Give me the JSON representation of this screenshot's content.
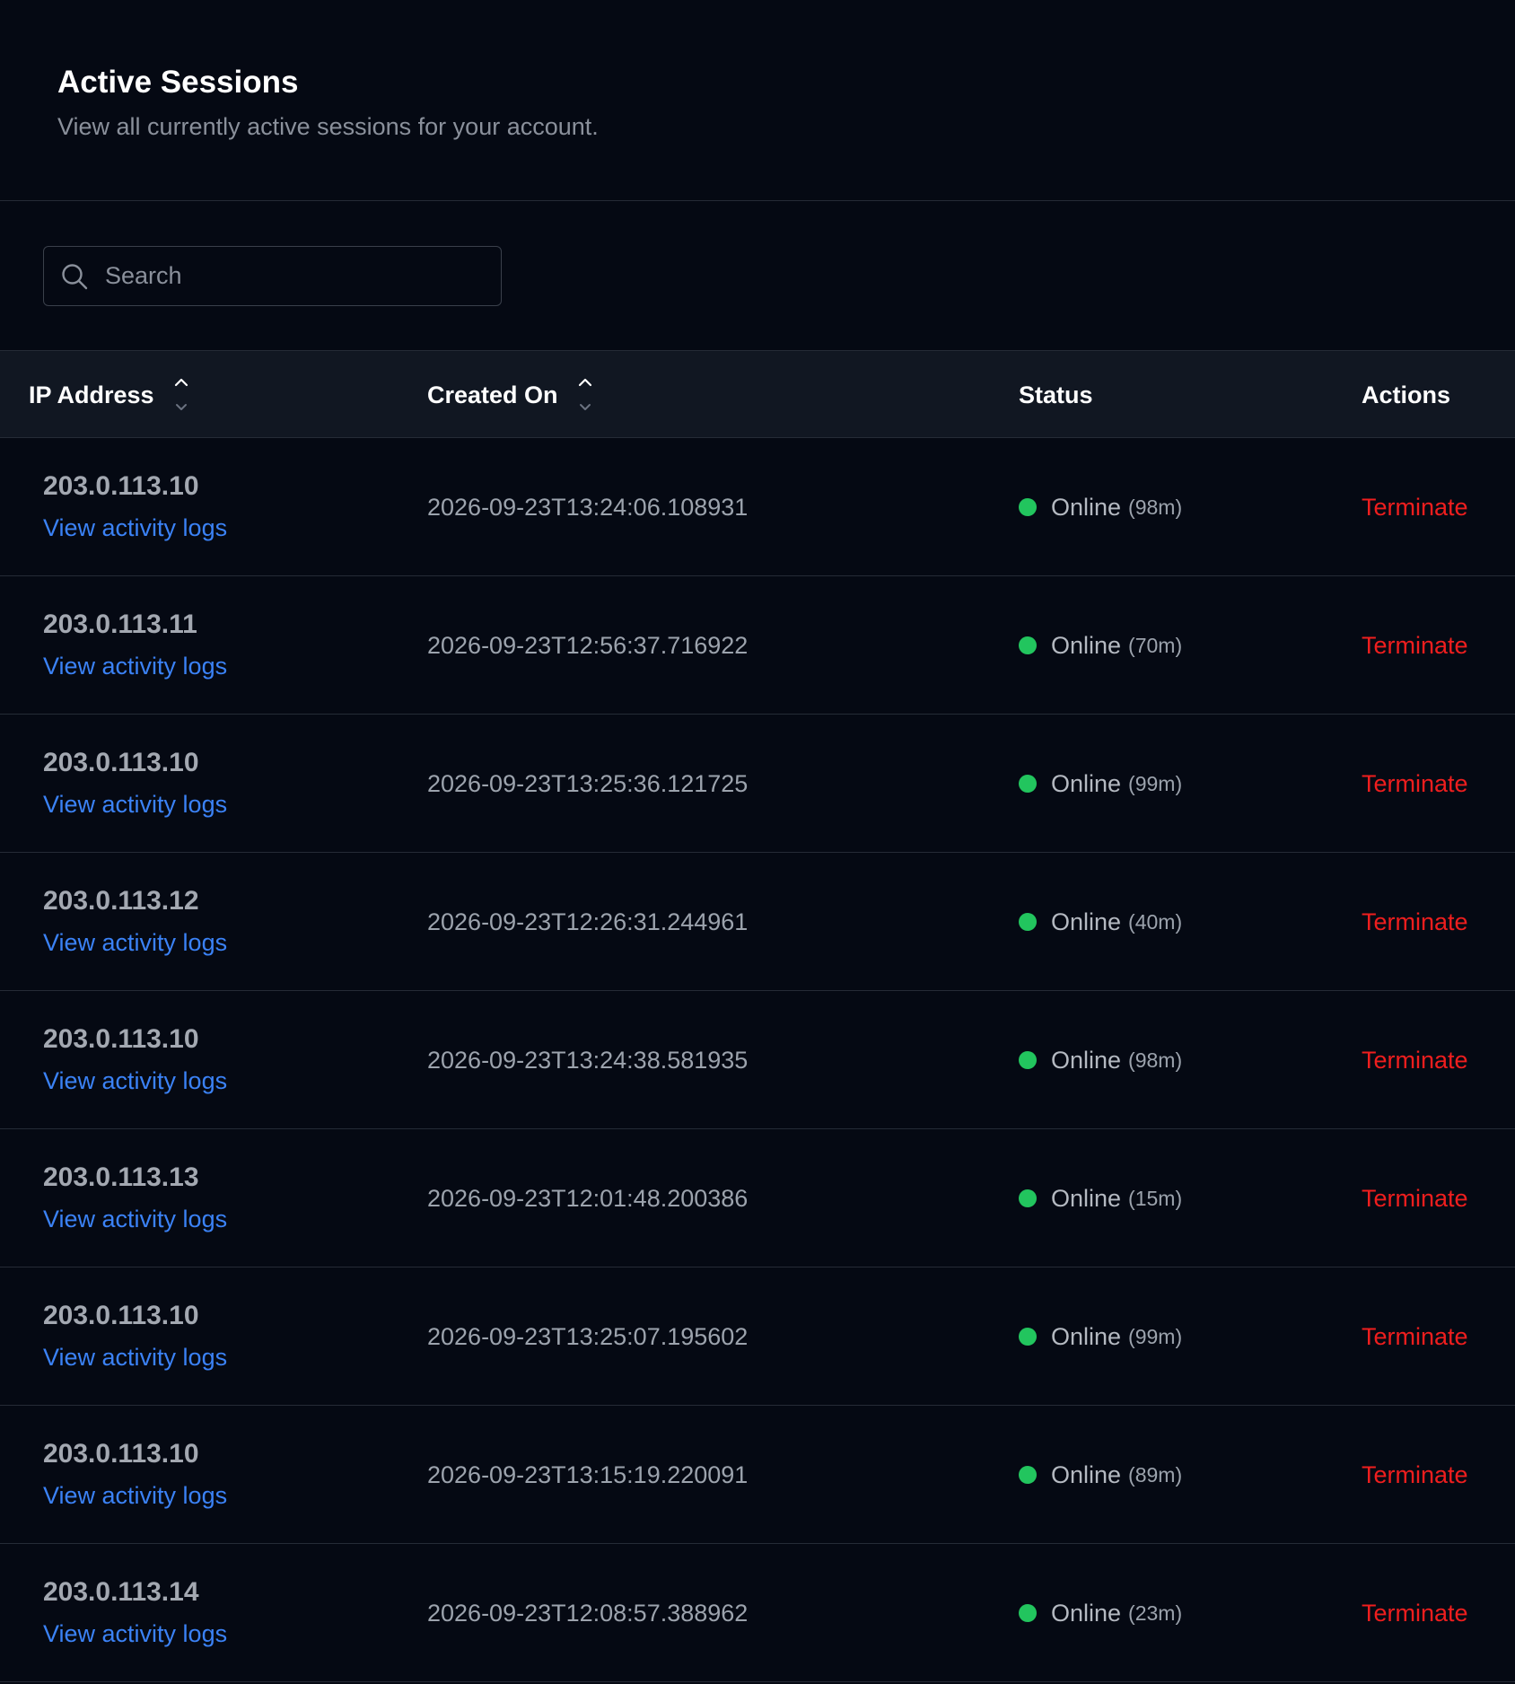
{
  "header": {
    "title": "Active Sessions",
    "subtitle": "View all currently active sessions for your account."
  },
  "search": {
    "placeholder": "Search",
    "value": "",
    "icon": "search-icon"
  },
  "table": {
    "columns": {
      "ip": "IP Address",
      "created": "Created On",
      "status": "Status",
      "actions": "Actions"
    },
    "rows": [
      {
        "ip": "203.0.113.10",
        "link": "View activity logs",
        "created": "2026-09-23T13:24:06.108931",
        "status": "Online",
        "duration": "(98m)",
        "action": "Terminate"
      },
      {
        "ip": "203.0.113.11",
        "link": "View activity logs",
        "created": "2026-09-23T12:56:37.716922",
        "status": "Online",
        "duration": "(70m)",
        "action": "Terminate"
      },
      {
        "ip": "203.0.113.10",
        "link": "View activity logs",
        "created": "2026-09-23T13:25:36.121725",
        "status": "Online",
        "duration": "(99m)",
        "action": "Terminate"
      },
      {
        "ip": "203.0.113.12",
        "link": "View activity logs",
        "created": "2026-09-23T12:26:31.244961",
        "status": "Online",
        "duration": "(40m)",
        "action": "Terminate"
      },
      {
        "ip": "203.0.113.10",
        "link": "View activity logs",
        "created": "2026-09-23T13:24:38.581935",
        "status": "Online",
        "duration": "(98m)",
        "action": "Terminate"
      },
      {
        "ip": "203.0.113.13",
        "link": "View activity logs",
        "created": "2026-09-23T12:01:48.200386",
        "status": "Online",
        "duration": "(15m)",
        "action": "Terminate"
      },
      {
        "ip": "203.0.113.10",
        "link": "View activity logs",
        "created": "2026-09-23T13:25:07.195602",
        "status": "Online",
        "duration": "(99m)",
        "action": "Terminate"
      },
      {
        "ip": "203.0.113.10",
        "link": "View activity logs",
        "created": "2026-09-23T13:15:19.220091",
        "status": "Online",
        "duration": "(89m)",
        "action": "Terminate"
      },
      {
        "ip": "203.0.113.14",
        "link": "View activity logs",
        "created": "2026-09-23T12:08:57.388962",
        "status": "Online",
        "duration": "(23m)",
        "action": "Terminate"
      }
    ]
  },
  "colors": {
    "background": "#050913",
    "header_row": "#111722",
    "link": "#3b82f6",
    "danger": "#ef1e1e",
    "online": "#22c55e"
  }
}
